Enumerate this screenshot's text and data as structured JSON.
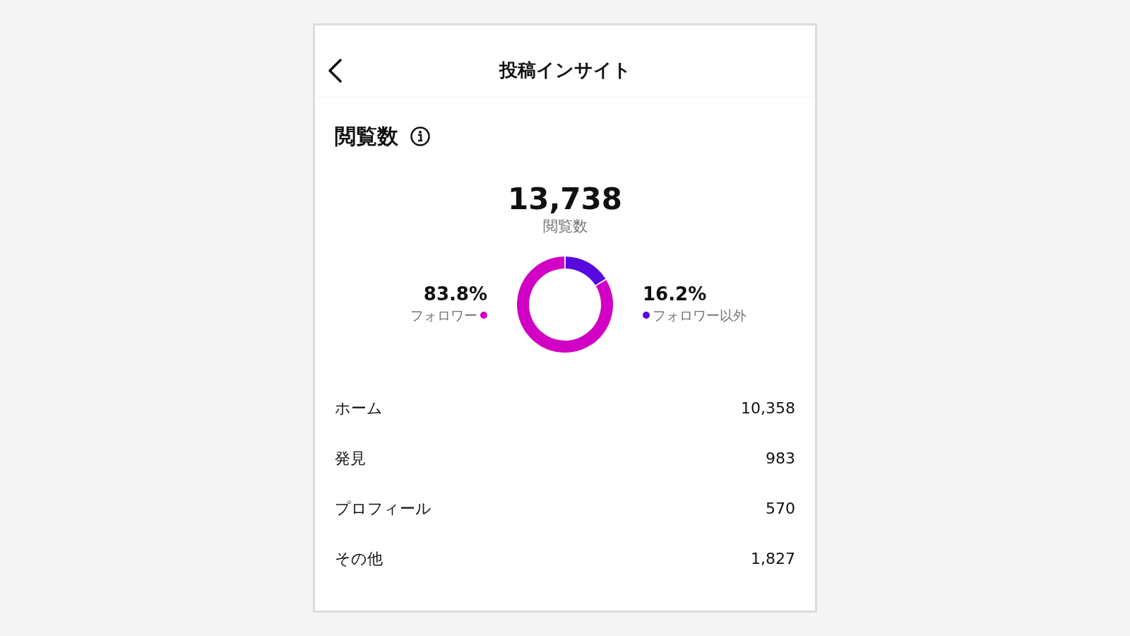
{
  "header": {
    "title": "投稿インサイト"
  },
  "section": {
    "title": "閲覧数"
  },
  "total": {
    "value": "13,738",
    "label": "閲覧数"
  },
  "legend": [
    {
      "percent": "83.8%",
      "label": "フォロワー",
      "color": "#d100c4"
    },
    {
      "percent": "16.2%",
      "label": "フォロワー以外",
      "color": "#5709df"
    }
  ],
  "chart_data": {
    "type": "donut",
    "values": [
      83.8,
      16.2
    ]
  },
  "rows": [
    {
      "label": "ホーム",
      "value": "10,358"
    },
    {
      "label": "発見",
      "value": "983"
    },
    {
      "label": "プロフィール",
      "value": "570"
    },
    {
      "label": "その他",
      "value": "1,827"
    }
  ]
}
